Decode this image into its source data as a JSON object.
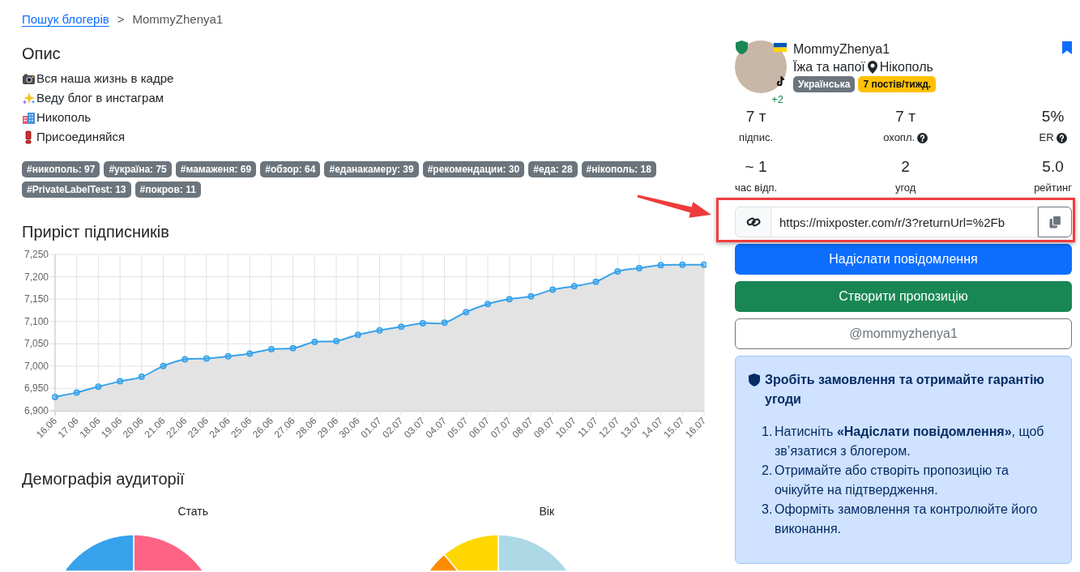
{
  "breadcrumb": {
    "separator": ">",
    "items": [
      {
        "label": "Пошук блогерів",
        "kind": "link"
      },
      {
        "label": "MommyZhenya1",
        "kind": "current"
      }
    ]
  },
  "description": {
    "title": "Опис",
    "lines": [
      "Вся наша жизнь в кадре",
      "Веду блог в инстаграм",
      "Никополь",
      "Присоединяйся"
    ],
    "tags": [
      "#никополь: 97",
      "#україна: 75",
      "#мамаженя: 69",
      "#обзор: 64",
      "#еданакамеру: 39",
      "#рекомендации: 30",
      "#еда: 28",
      "#нікополь: 18",
      "#PrivateLabelTest: 13",
      "#покров: 11"
    ]
  },
  "growth": {
    "title": "Приріст підписників",
    "chart_data": {
      "type": "area",
      "grid": true,
      "categories": [
        "16.06",
        "17.06",
        "18.06",
        "19.06",
        "20.06",
        "21.06",
        "22.06",
        "23.06",
        "24.06",
        "25.06",
        "26.06",
        "27.06",
        "28.06",
        "29.06",
        "30.06",
        "01.07",
        "02.07",
        "03.07",
        "04.07",
        "05.07",
        "06.07",
        "07.07",
        "08.07",
        "09.07",
        "10.07",
        "11.07",
        "12.07",
        "13.07",
        "14.07",
        "15.07",
        "16.07"
      ],
      "series": [
        {
          "color": "#36a2eb",
          "values": [
            6931,
            6941,
            6954,
            6966,
            6976,
            7000,
            7015,
            7017,
            7022,
            7028,
            7038,
            7040,
            7054,
            7056,
            7070,
            7080,
            7088,
            7096,
            7097,
            7121,
            7139,
            7150,
            7156,
            7171,
            7179,
            7189,
            7212,
            7219,
            7226,
            7227,
            7227
          ]
        }
      ],
      "ylim": [
        6900,
        7250
      ],
      "yticks": [
        {
          "value": 6900,
          "label": "6,900"
        },
        {
          "value": 6950,
          "label": "6,950"
        },
        {
          "value": 7000,
          "label": "7,000"
        },
        {
          "value": 7050,
          "label": "7,050"
        },
        {
          "value": 7100,
          "label": "7,100"
        },
        {
          "value": 7150,
          "label": "7,150"
        },
        {
          "value": 7200,
          "label": "7,200"
        },
        {
          "value": 7250,
          "label": "7,250"
        }
      ]
    }
  },
  "demographics": {
    "title": "Демографія аудиторії",
    "charts": [
      {
        "title": "Стать"
      },
      {
        "title": "Вік"
      }
    ]
  },
  "profile": {
    "name": "MommyZhenya1",
    "verified": true,
    "bookmarked": true,
    "extra_count": "+2",
    "category": "Їжа та напої",
    "city": "Нікополь",
    "badges": [
      {
        "label": "Українська",
        "color": "#6c757d"
      },
      {
        "label": "7 постів/тижд.",
        "color": "#ffc107"
      }
    ],
    "stats": [
      {
        "value": "7 т",
        "label": "підпис.",
        "help": false
      },
      {
        "value": "7 т",
        "label": "охопл.",
        "help": true
      },
      {
        "value": "5%",
        "label": "ER",
        "help": true
      },
      {
        "value": "~ 1",
        "label": "час відп.",
        "help": false
      },
      {
        "value": "2",
        "label": "угод",
        "help": false
      },
      {
        "value": "5.0",
        "label": "рейтинг",
        "help": false
      }
    ]
  },
  "link_field": {
    "value": "https://mixposter.com/r/3?returnUrl=%2Fb",
    "highlighted": true
  },
  "buttons": [
    {
      "label": "Надіслати повідомлення",
      "kind": "primary"
    },
    {
      "label": "Створити пропозицію",
      "kind": "success"
    },
    {
      "label": "@mommyzhenya1",
      "kind": "outline"
    }
  ],
  "guarantee": {
    "title": "Зробіть замовлення та отримайте гарантію угоди",
    "steps": [
      {
        "number": "1.",
        "text": "Натисніть **«Надіслати повідомлення»**, щоб зв’язатися з блогером."
      },
      {
        "number": "2.",
        "text": "Отримайте або створіть пропозицію та очікуйте на підтвердження."
      },
      {
        "number": "3.",
        "text": "Оформіть замовлення та контролюйте його виконання."
      }
    ]
  }
}
